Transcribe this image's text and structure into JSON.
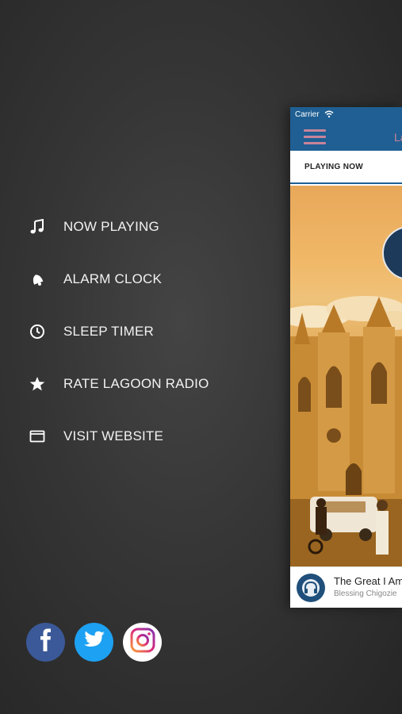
{
  "menu": {
    "items": [
      {
        "label": "NOW PLAYING",
        "icon": "music-note-icon"
      },
      {
        "label": "ALARM CLOCK",
        "icon": "bell-icon"
      },
      {
        "label": "SLEEP TIMER",
        "icon": "clock-icon"
      },
      {
        "label": "RATE LAGOON RADIO",
        "icon": "star-icon"
      },
      {
        "label": "VISIT WEBSITE",
        "icon": "browser-window-icon"
      }
    ]
  },
  "socials": [
    {
      "name": "facebook",
      "icon": "facebook-icon",
      "color": "#3b5998"
    },
    {
      "name": "twitter",
      "icon": "twitter-icon",
      "color": "#1da1f2"
    },
    {
      "name": "instagram",
      "icon": "instagram-icon",
      "color": "#ffffff"
    }
  ],
  "app": {
    "status_bar": {
      "carrier": "Carrier"
    },
    "title": "La",
    "tab": "PLAYING NOW",
    "now_playing": {
      "title": "The Great I Am",
      "artist": "Blessing Chigozie"
    },
    "accent_color": "#1f5f93"
  }
}
